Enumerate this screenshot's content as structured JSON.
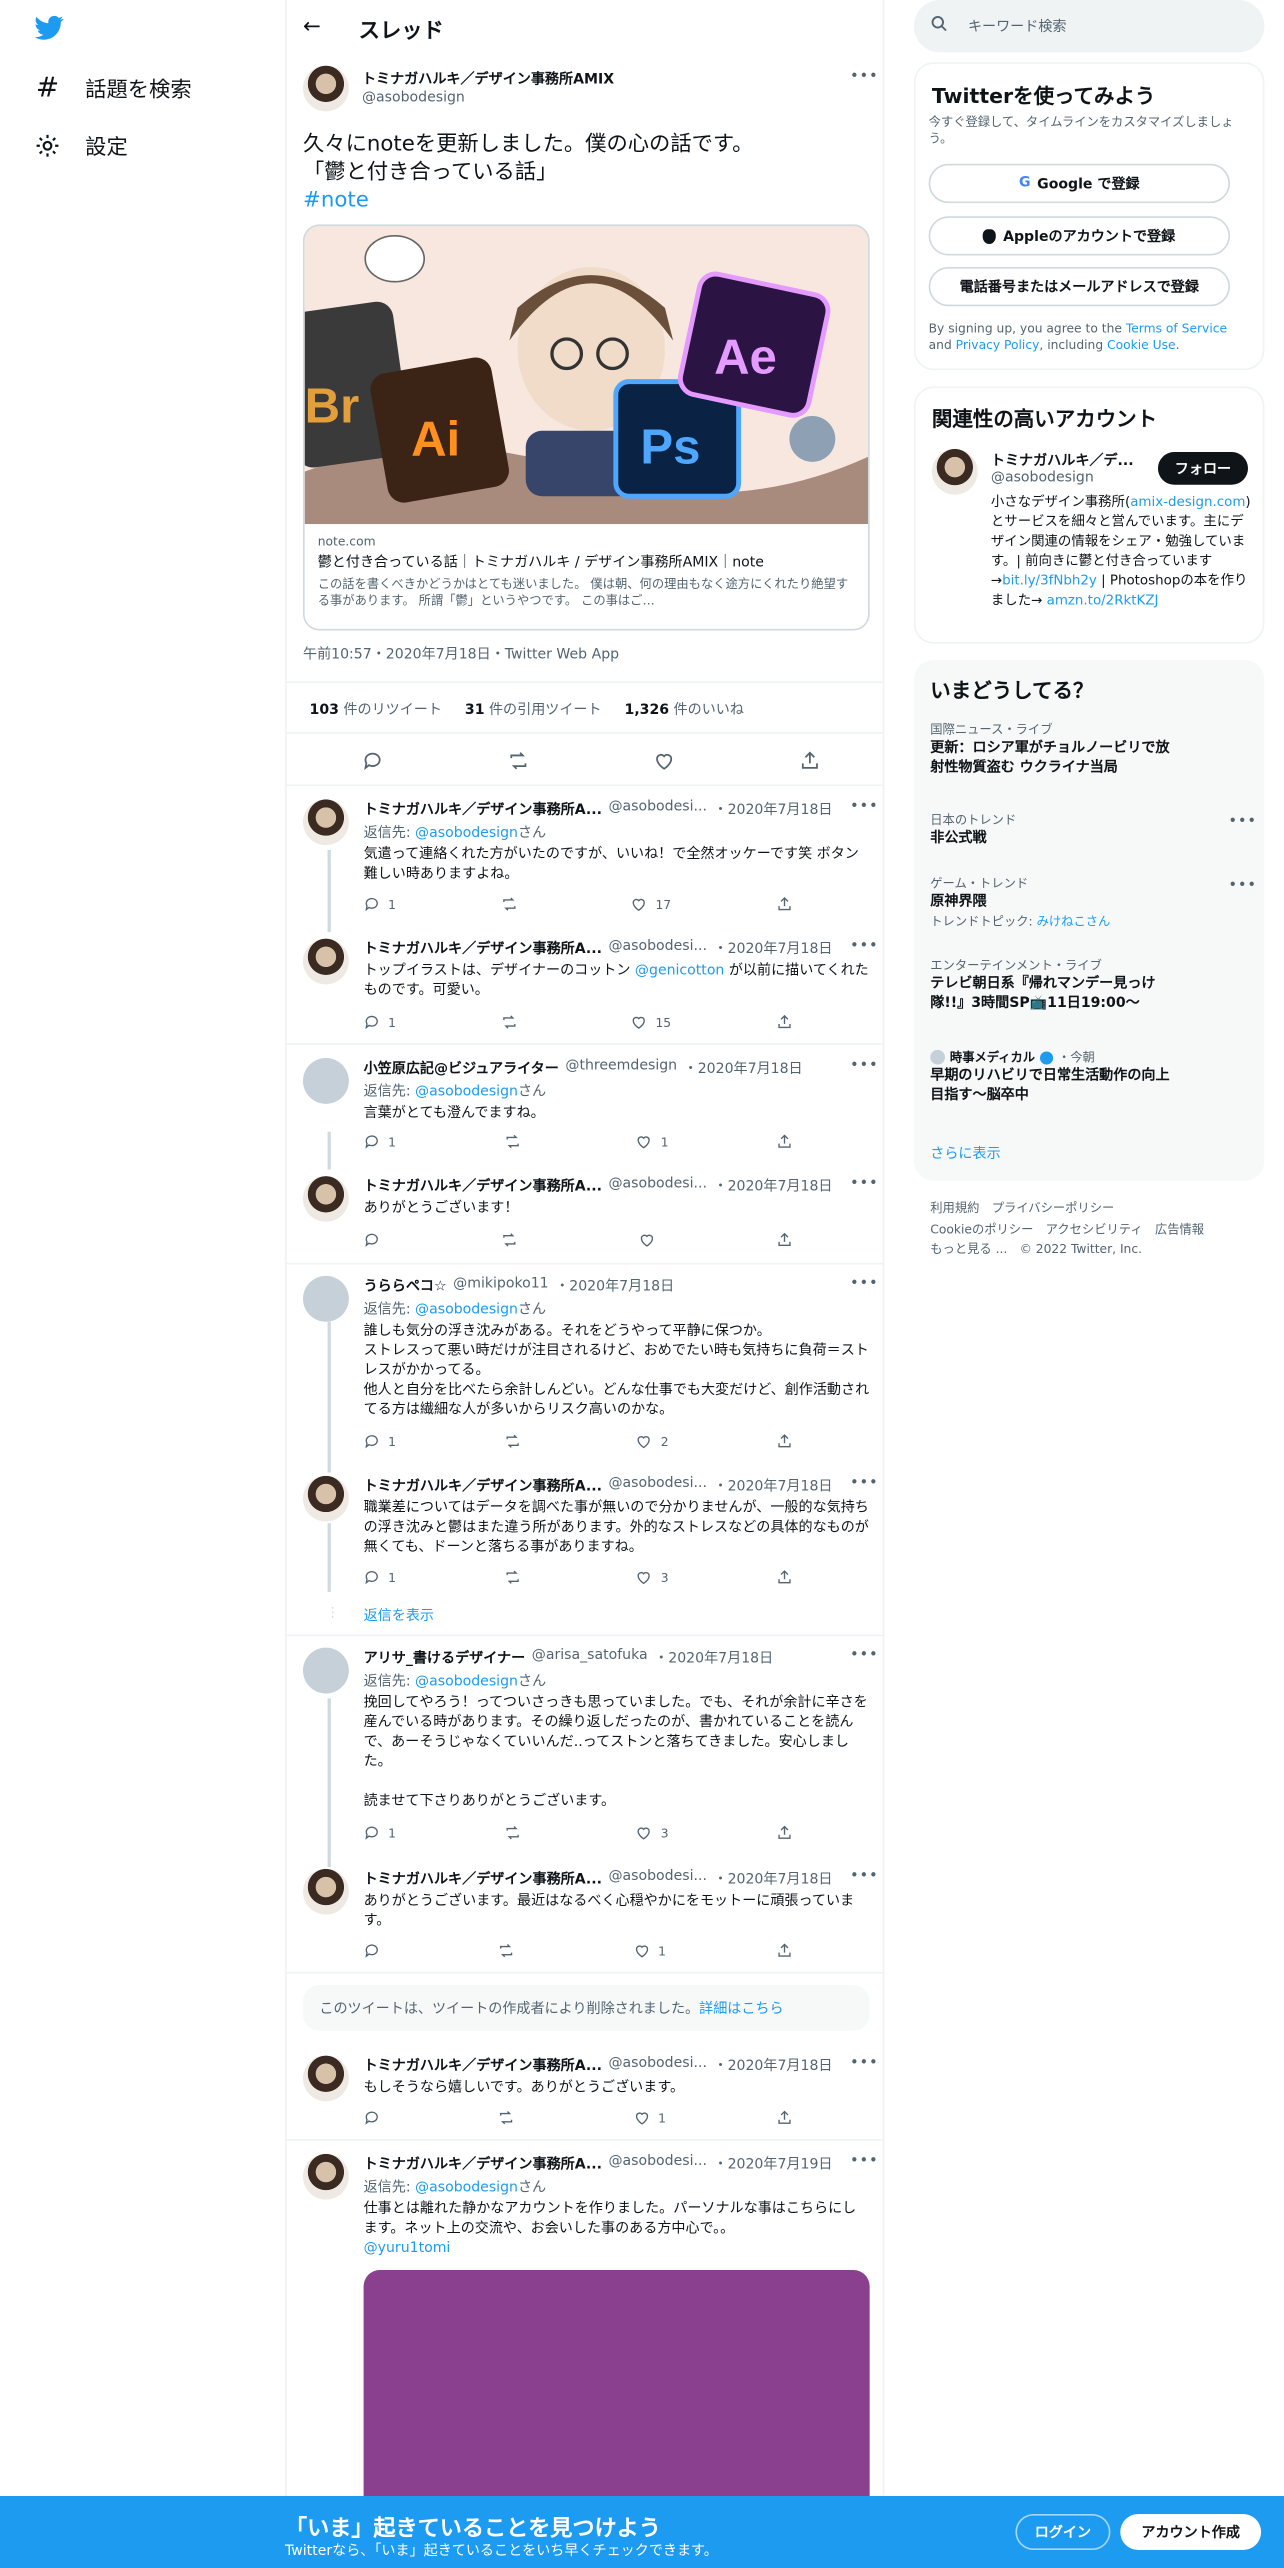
{
  "nav": {
    "explore": "話題を検索",
    "settings": "設定"
  },
  "header": {
    "title": "スレッド"
  },
  "main_tweet": {
    "name": "トミナガハルキ／デザイン事務所AMIX",
    "handle": "@asobodesign",
    "line1": "久々にnoteを更新しました。僕の心の話です。",
    "line2": "「鬱と付き合っている話」",
    "hashtag": "#note",
    "card_domain": "note.com",
    "card_title": "鬱と付き合っている話｜トミナガハルキ / デザイン事務所AMIX｜note",
    "card_desc": "この話を書くべきかどうかはとても迷いました。 僕は朝、何の理由もなく途方にくれたり絶望する事があります。 所謂「鬱」というやつです。 この事はご…",
    "timestamp": "午前10:57・2020年7月18日・Twitter Web App",
    "retweets_count": "103",
    "retweets_label": "件のリツイート",
    "quotes_count": "31",
    "quotes_label": "件の引用ツイート",
    "likes_count": "1,326",
    "likes_label": "件のいいね"
  },
  "replies": [
    {
      "name": "トミナガハルキ／デザイン事務所A...",
      "handle": "@asobodesi...",
      "date": "・2020年7月18日",
      "reply_to_prefix": "返信先: ",
      "reply_to": "@asobodesign",
      "reply_to_suffix": "さん",
      "text": "気遣って連絡くれた方がいたのですが、いいね！で全然オッケーです笑 ボタン難しい時ありますよね。",
      "replies": "1",
      "retweets": "",
      "likes": "17"
    },
    {
      "name": "トミナガハルキ／デザイン事務所A...",
      "handle": "@asobodesi...",
      "date": "・2020年7月18日",
      "text_a": "トップイラストは、デザイナーのコットン ",
      "mention": "@genicotton",
      "text_b": " が以前に描いてくれたものです。可愛い。",
      "replies": "1",
      "retweets": "",
      "likes": "15"
    },
    {
      "name": "小笠原広記@ビジュアライター",
      "handle": "@threemdesign",
      "date": "・2020年7月18日",
      "reply_to_prefix": "返信先: ",
      "reply_to": "@asobodesign",
      "reply_to_suffix": "さん",
      "text": "言葉がとても澄んでますね。",
      "replies": "1",
      "retweets": "",
      "likes": "1"
    },
    {
      "name": "トミナガハルキ／デザイン事務所A...",
      "handle": "@asobodesi...",
      "date": "・2020年7月18日",
      "text": "ありがとうございます！",
      "replies": "",
      "retweets": "",
      "likes": ""
    },
    {
      "name": "うららペコ☆",
      "handle": "@mikipoko11",
      "date": "・2020年7月18日",
      "reply_to_prefix": "返信先: ",
      "reply_to": "@asobodesign",
      "reply_to_suffix": "さん",
      "text_l1": "誰しも気分の浮き沈みがある。それをどうやって平静に保つか。",
      "text_l2": "ストレスって悪い時だけが注目されるけど、おめでたい時も気持ちに負荷＝ストレスがかかってる。",
      "text_l3": "他人と自分を比べたら余計しんどい。どんな仕事でも大変だけど、創作活動されてる方は繊細な人が多いからリスク高いのかな。",
      "replies": "1",
      "retweets": "",
      "likes": "2"
    },
    {
      "name": "トミナガハルキ／デザイン事務所A...",
      "handle": "@asobodesi...",
      "date": "・2020年7月18日",
      "text": "職業差についてはデータを調べた事が無いので分かりませんが、一般的な気持ちの浮き沈みと鬱はまた違う所があります。外的なストレスなどの具体的なものが無くても、ドーンと落ちる事がありますね。",
      "replies": "1",
      "retweets": "",
      "likes": "3"
    },
    {
      "name": "アリサ_書けるデザイナー",
      "handle": "@arisa_satofuka",
      "date": "・2020年7月18日",
      "reply_to_prefix": "返信先: ",
      "reply_to": "@asobodesign",
      "reply_to_suffix": "さん",
      "text_l1": "挽回してやろう！ってついさっきも思っていました。でも、それが余計に辛さを産んでいる時があります。その繰り返しだったのが、書かれていることを読んで、あーそうじゃなくていいんだ..ってストンと落ちてきました。安心しました。",
      "text_l2": "読ませて下さりありがとうございます。",
      "replies": "1",
      "retweets": "",
      "likes": "3"
    },
    {
      "name": "トミナガハルキ／デザイン事務所A...",
      "handle": "@asobodesi...",
      "date": "・2020年7月18日",
      "text": "ありがとうございます。最近はなるべく心穏やかにをモットーに頑張っています。",
      "replies": "",
      "retweets": "",
      "likes": "1"
    },
    {
      "name": "トミナガハルキ／デザイン事務所A...",
      "handle": "@asobodesi...",
      "date": "・2020年7月18日",
      "text": "もしそうなら嬉しいです。ありがとうございます。",
      "replies": "",
      "retweets": "",
      "likes": "1"
    },
    {
      "name": "トミナガハルキ／デザイン事務所A...",
      "handle": "@asobodesi...",
      "date": "・2020年7月19日",
      "reply_to_prefix": "返信先: ",
      "reply_to": "@asobodesign",
      "reply_to_suffix": "さん",
      "text": "仕事とは離れた静かなアカウントを作りました。パーソナルな事はこちらにします。ネット上の交流や、お会いした事のある方中心で。。",
      "mention": "@yuru1tomi"
    }
  ],
  "show_replies": "返信を表示",
  "deleted": {
    "text": "このツイートは、ツイートの作成者により削除されました。",
    "link": "詳細はこちら"
  },
  "right": {
    "search_placeholder": "キーワード検索",
    "signup": {
      "title": "Twitterを使ってみよう",
      "subtitle": "今すぐ登録して、タイムラインをカスタマイズしましょう。",
      "google": "Google で登録",
      "apple": "Appleのアカウントで登録",
      "phone": "電話番号またはメールアドレスで登録",
      "terms_a": "By signing up, you agree to the ",
      "terms_link1": "Terms of Service",
      "terms_b": " and ",
      "terms_link2": "Privacy Policy",
      "terms_c": ", including ",
      "terms_link3": "Cookie Use",
      "terms_d": "."
    },
    "related": {
      "title": "関連性の高いアカウント",
      "name": "トミナガハルキ／デ...",
      "handle": "@asobodesign",
      "follow": "フォロー",
      "bio_a": "小さなデザイン事務所(",
      "bio_link1": "amix-design.com",
      "bio_b": ")とサービスを細々と営んでいます。主にデザイン関連の情報をシェア・勉強しています。| 前向きに鬱と付き合っています→",
      "bio_link2": "bit.ly/3fNbh2y",
      "bio_c": " | Photoshopの本を作りました→ ",
      "bio_link3": "amzn.to/2RktKZJ"
    },
    "trends": {
      "title": "いまどうしてる？",
      "items": [
        {
          "cat": "国際ニュース・ライブ",
          "t": "更新：ロシア軍がチョルノービリで放射性物質盗む ウクライナ当局"
        },
        {
          "cat": "日本のトレンド",
          "t": "非公式戦"
        },
        {
          "cat": "ゲーム・トレンド",
          "t": "原神界隈",
          "sub_prefix": "トレンドトピック: ",
          "sub": "みけねこさん"
        },
        {
          "cat": "エンターテインメント・ライブ",
          "t": "テレビ朝日系『帰れマンデー見っけ隊!!』3時間SP📺11日19:00〜"
        },
        {
          "source": "時事メディカル",
          "time": "・今朝",
          "t": "早期のリハビリで日常生活動作の向上目指す～脳卒中"
        }
      ],
      "more": "さらに表示"
    },
    "footer": {
      "l1a": "利用規約",
      "l1b": "プライバシーポリシー",
      "l2a": "Cookieのポリシー",
      "l2b": "アクセシビリティ",
      "l2c": "広告情報",
      "l3a": "もっと見る ...",
      "l3b": "© 2022 Twitter, Inc."
    }
  },
  "bottom": {
    "headline": "「いま」起きていることを見つけよう",
    "sub": "Twitterなら、「いま」起きていることをいち早くチェックできます。",
    "login": "ログイン",
    "signup": "アカウント作成"
  },
  "colors": {
    "accent": "#1d9bf0",
    "text": "#0f1419",
    "muted": "#536471"
  }
}
